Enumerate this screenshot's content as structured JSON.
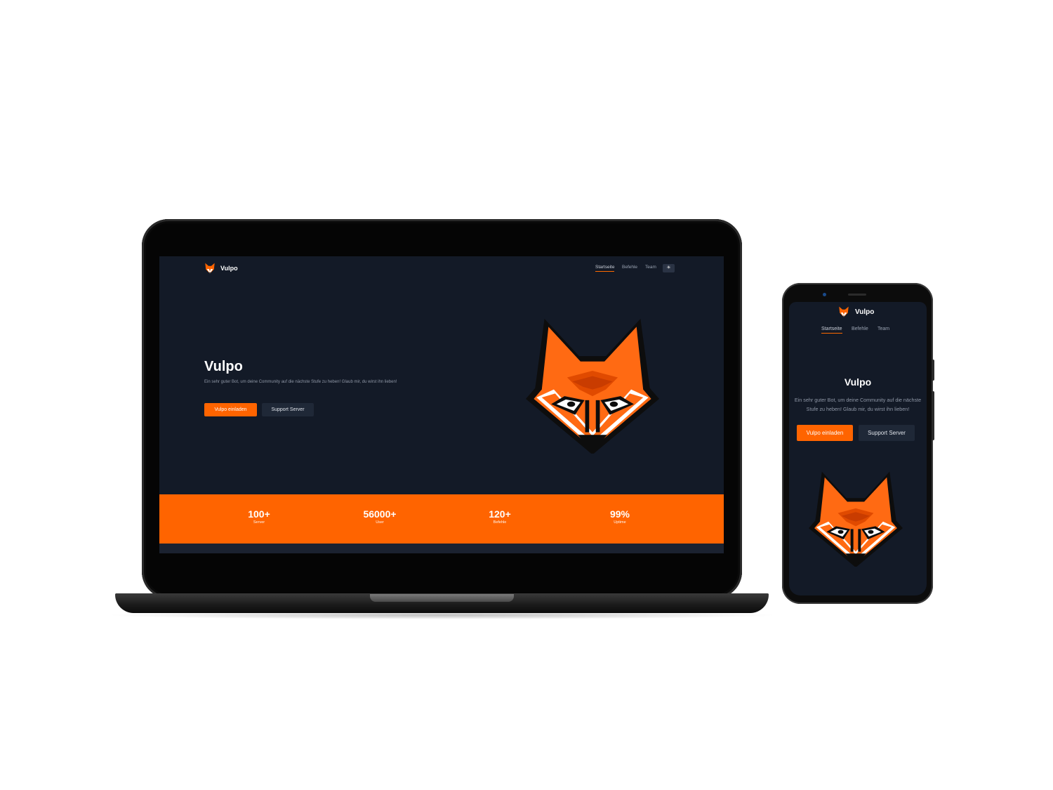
{
  "site": {
    "brand": "Vulpo",
    "nav": {
      "home": "Startseite",
      "commands": "Befehle",
      "team": "Team",
      "theme_icon": "sun-icon"
    },
    "hero": {
      "title": "Vulpo",
      "description": "Ein sehr guter Bot, um deine Community auf die nächste Stufe zu heben! Glaub mir, du wirst ihn lieben!",
      "invite_button": "Vulpo einladen",
      "support_button": "Support Server"
    },
    "stats": [
      {
        "value": "100+",
        "label": "Server"
      },
      {
        "value": "56000+",
        "label": "User"
      },
      {
        "value": "120+",
        "label": "Befehle"
      },
      {
        "value": "99%",
        "label": "Uptime"
      }
    ],
    "colors": {
      "accent": "#ff6400",
      "background": "#131a27",
      "secondary_button": "#1f2837"
    }
  }
}
